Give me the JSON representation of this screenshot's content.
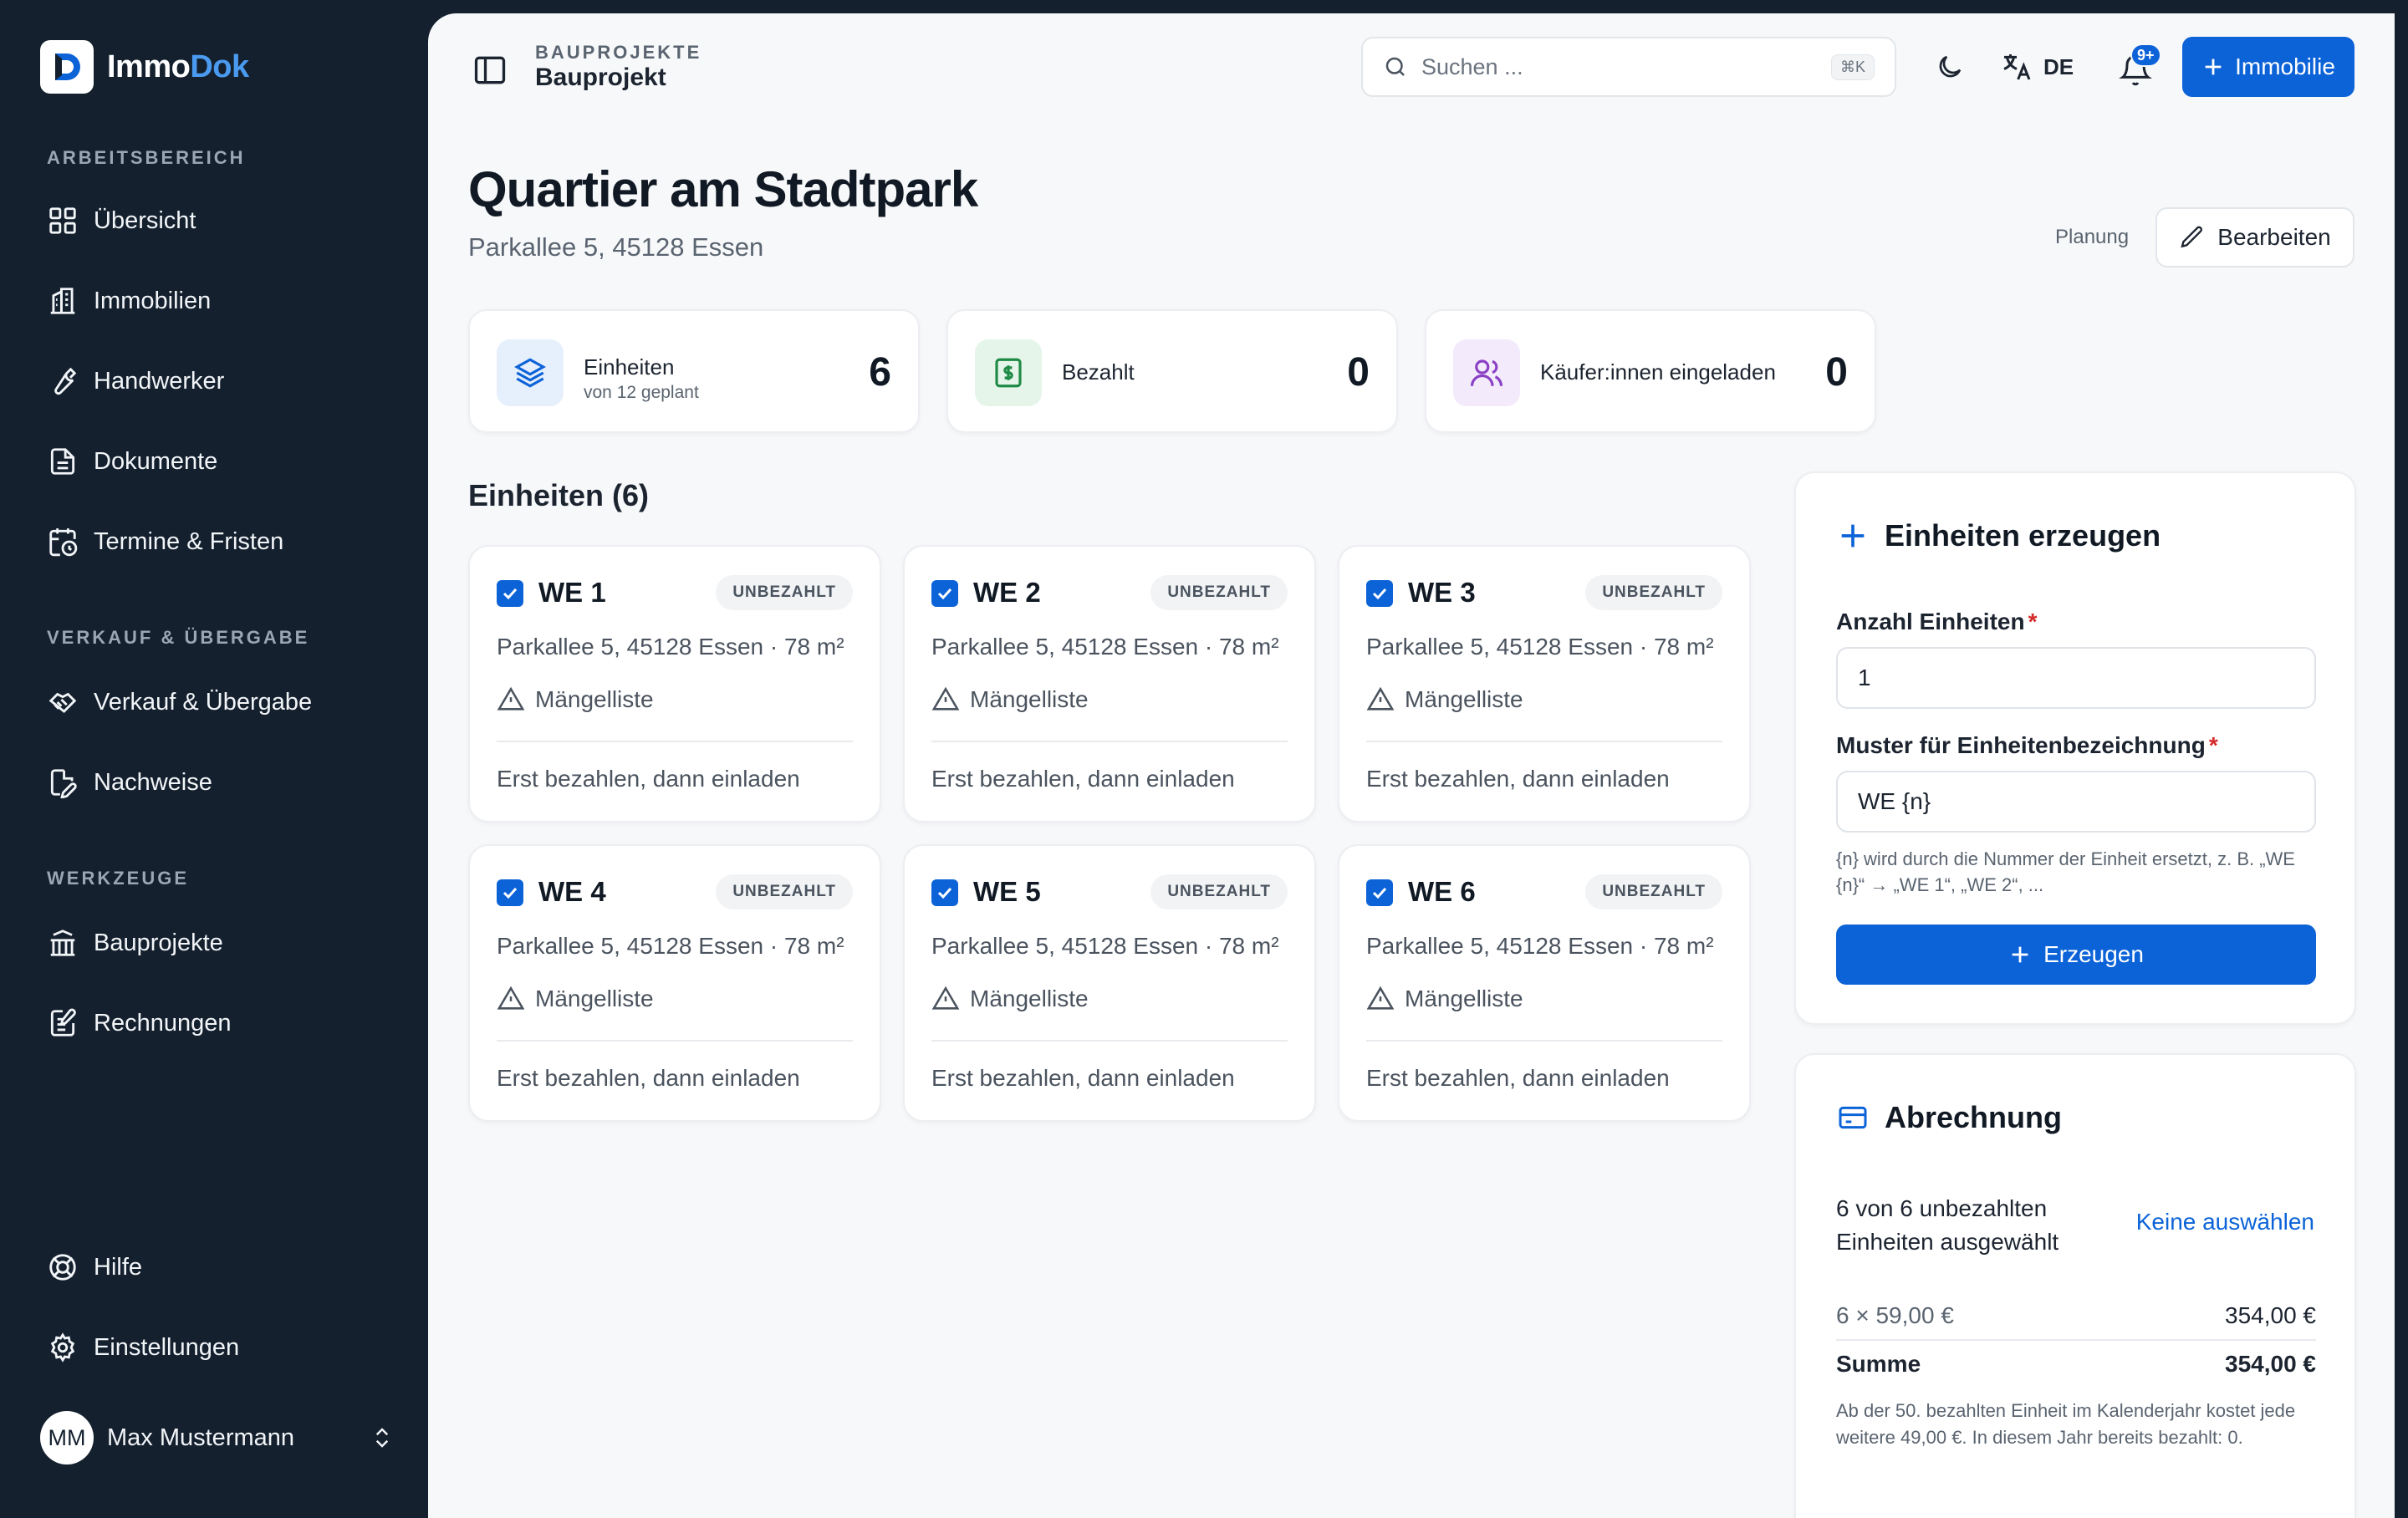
{
  "sidebar": {
    "brand_a": "Immo",
    "brand_b": "Dok",
    "sections": {
      "workspace": "ARBEITSBEREICH",
      "sales": "VERKAUF & ÜBERGABE",
      "tools": "WERKZEUGE"
    },
    "items": {
      "overview": "Übersicht",
      "properties": "Immobilien",
      "craftsmen": "Handwerker",
      "documents": "Dokumente",
      "deadlines": "Termine & Fristen",
      "sale_handover": "Verkauf & Übergabe",
      "proofs": "Nachweise",
      "construction_projects": "Bauprojekte",
      "invoices": "Rechnungen",
      "help": "Hilfe",
      "settings": "Einstellungen"
    },
    "user": {
      "initials": "MM",
      "name": "Max Mustermann"
    }
  },
  "header": {
    "breadcrumb_parent": "BAUPROJEKTE",
    "breadcrumb_current": "Bauprojekt",
    "search_placeholder": "Suchen ...",
    "search_shortcut": "⌘K",
    "language": "DE",
    "notification_count": "9+",
    "new_property_label": "Immobilie"
  },
  "project": {
    "title": "Quartier am Stadtpark",
    "address": "Parkallee 5, 45128 Essen",
    "status": "Planung",
    "edit_label": "Bearbeiten"
  },
  "stats": {
    "units": {
      "label": "Einheiten",
      "sub": "von 12 geplant",
      "value": "6"
    },
    "paid": {
      "label": "Bezahlt",
      "value": "0"
    },
    "buyers": {
      "label": "Käufer:innen eingeladen",
      "value": "0"
    }
  },
  "units_section_title": "Einheiten (6)",
  "units": [
    {
      "name": "WE 1",
      "status": "UNBEZAHLT",
      "address": "Parkallee 5, 45128 Essen · 78 m²",
      "defects": "Mängelliste",
      "note": "Erst bezahlen, dann einladen",
      "selected": true
    },
    {
      "name": "WE 2",
      "status": "UNBEZAHLT",
      "address": "Parkallee 5, 45128 Essen · 78 m²",
      "defects": "Mängelliste",
      "note": "Erst bezahlen, dann einladen",
      "selected": true
    },
    {
      "name": "WE 3",
      "status": "UNBEZAHLT",
      "address": "Parkallee 5, 45128 Essen · 78 m²",
      "defects": "Mängelliste",
      "note": "Erst bezahlen, dann einladen",
      "selected": true
    },
    {
      "name": "WE 4",
      "status": "UNBEZAHLT",
      "address": "Parkallee 5, 45128 Essen · 78 m²",
      "defects": "Mängelliste",
      "note": "Erst bezahlen, dann einladen",
      "selected": true
    },
    {
      "name": "WE 5",
      "status": "UNBEZAHLT",
      "address": "Parkallee 5, 45128 Essen · 78 m²",
      "defects": "Mängelliste",
      "note": "Erst bezahlen, dann einladen",
      "selected": true
    },
    {
      "name": "WE 6",
      "status": "UNBEZAHLT",
      "address": "Parkallee 5, 45128 Essen · 78 m²",
      "defects": "Mängelliste",
      "note": "Erst bezahlen, dann einladen",
      "selected": true
    }
  ],
  "generate": {
    "title": "Einheiten erzeugen",
    "count_label": "Anzahl Einheiten",
    "count_value": "1",
    "pattern_label": "Muster für Einheitenbezeichnung",
    "pattern_value": "WE {n}",
    "required_mark": "*",
    "hint": "{n} wird durch die Nummer der Einheit ersetzt, z. B. „WE {n}“ → „WE 1“, „WE 2“, ...",
    "button_label": "Erzeugen"
  },
  "billing": {
    "title": "Abrechnung",
    "selection_text": "6 von 6 unbezahlten Einheiten ausgewählt",
    "deselect_label": "Keine auswählen",
    "line_label": "6 × 59,00 €",
    "line_value": "354,00 €",
    "total_label": "Summe",
    "total_value": "354,00 €",
    "fine_print": "Ab der 50. bezahlten Einheit im Kalenderjahr kostet jede weitere 49,00 €. In diesem Jahr bereits bezahlt: 0."
  },
  "colors": {
    "sidebar_bg": "#14202e",
    "accent": "#0c63d8",
    "brand_accent": "#4a9bf0",
    "required": "#d62a2a",
    "page_bg": "#f7f8fa"
  }
}
